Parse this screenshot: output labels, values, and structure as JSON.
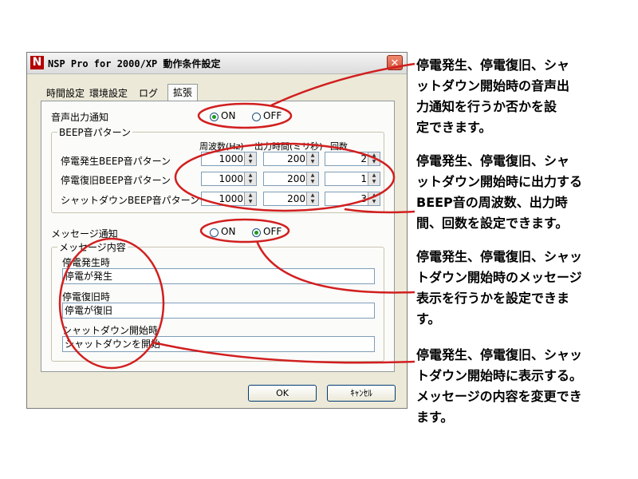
{
  "window": {
    "title": "NSP Pro for 2000/XP 動作条件設定",
    "icon_letter": "N"
  },
  "tabs": [
    "時間設定",
    "環境設定",
    "ログ",
    "拡張"
  ],
  "voice": {
    "label": "音声出力通知",
    "on_label": "ON",
    "off_label": "OFF",
    "selected": "ON"
  },
  "beep": {
    "group_label": "BEEP音パターン",
    "col_freq": "周波数(Hz)",
    "col_time": "出力時間(ミリ秒)",
    "col_count": "回数",
    "rows": [
      {
        "label": "停電発生BEEP音パターン",
        "freq": "1000",
        "time": "200",
        "count": "2"
      },
      {
        "label": "停電復旧BEEP音パターン",
        "freq": "1000",
        "time": "200",
        "count": "1"
      },
      {
        "label": "シャットダウンBEEP音パターン",
        "freq": "1000",
        "time": "200",
        "count": "3"
      }
    ]
  },
  "message": {
    "label": "メッセージ通知",
    "on_label": "ON",
    "off_label": "OFF",
    "selected": "OFF",
    "group_label": "メッセージ内容",
    "fields": [
      {
        "label": "停電発生時",
        "value": "停電が発生"
      },
      {
        "label": "停電復旧時",
        "value": "停電が復旧"
      },
      {
        "label": "シャットダウン開始時",
        "value": "シャットダウンを開始"
      }
    ]
  },
  "buttons": {
    "ok": "OK",
    "cancel": "ｷｬﾝｾﾙ"
  },
  "annotations": [
    [
      "停電発生、停電復旧、シャ",
      "ットダウン開始時の音声出",
      "力通知を行うか否かを設",
      "定できます。"
    ],
    [
      "停電発生、停電復旧、シャ",
      "ットダウン開始時に出力する",
      "BEEP音の周波数、出力時",
      "間、回数を設定できます。"
    ],
    [
      "停電発生、停電復旧、シャッ",
      "トダウン開始時のメッセージ",
      "表示を行うかを設定できま",
      "す。"
    ],
    [
      "停電発生、停電復旧、シャッ",
      "トダウン開始時に表示する。",
      "メッセージの内容を変更でき",
      "ます。"
    ]
  ],
  "colors": {
    "annotation_line": "#d11f1f",
    "radio_dot": "#1e9a1e"
  }
}
